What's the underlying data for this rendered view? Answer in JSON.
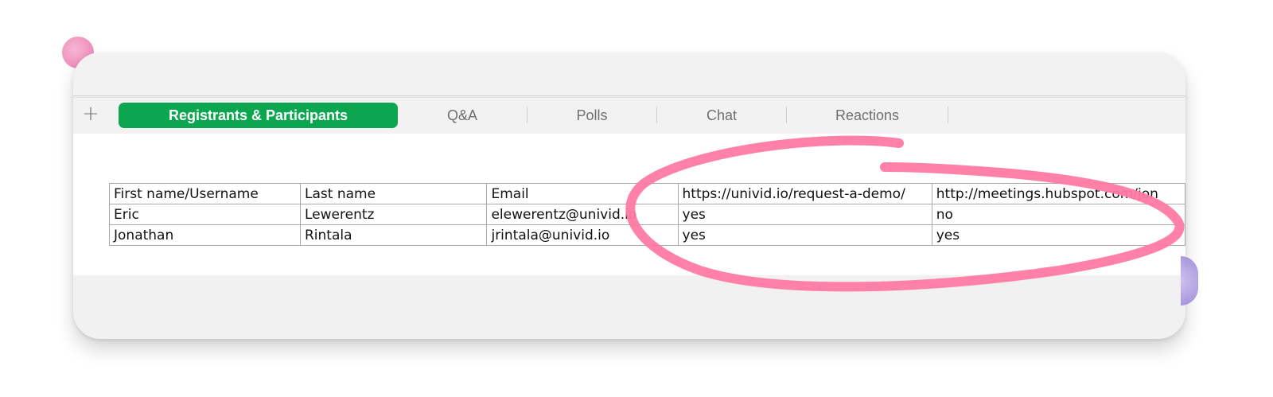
{
  "tabs": {
    "add_label": "+",
    "items": [
      {
        "label": "Registrants & Participants",
        "active": true
      },
      {
        "label": "Q&A",
        "active": false
      },
      {
        "label": "Polls",
        "active": false
      },
      {
        "label": "Chat",
        "active": false
      },
      {
        "label": "Reactions",
        "active": false
      }
    ]
  },
  "table": {
    "headers": [
      "First name/Username",
      "Last name",
      "Email",
      "https://univid.io/request-a-demo/",
      "http://meetings.hubspot.com/jon"
    ],
    "rows": [
      [
        "Eric",
        "Lewerentz",
        "elewerentz@univid.io",
        "yes",
        "no"
      ],
      [
        "Jonathan",
        "Rintala",
        "jrintala@univid.io",
        "yes",
        "yes"
      ]
    ]
  },
  "colors": {
    "active_tab": "#0ca650",
    "annotation_stroke": "#ff7aa3"
  }
}
